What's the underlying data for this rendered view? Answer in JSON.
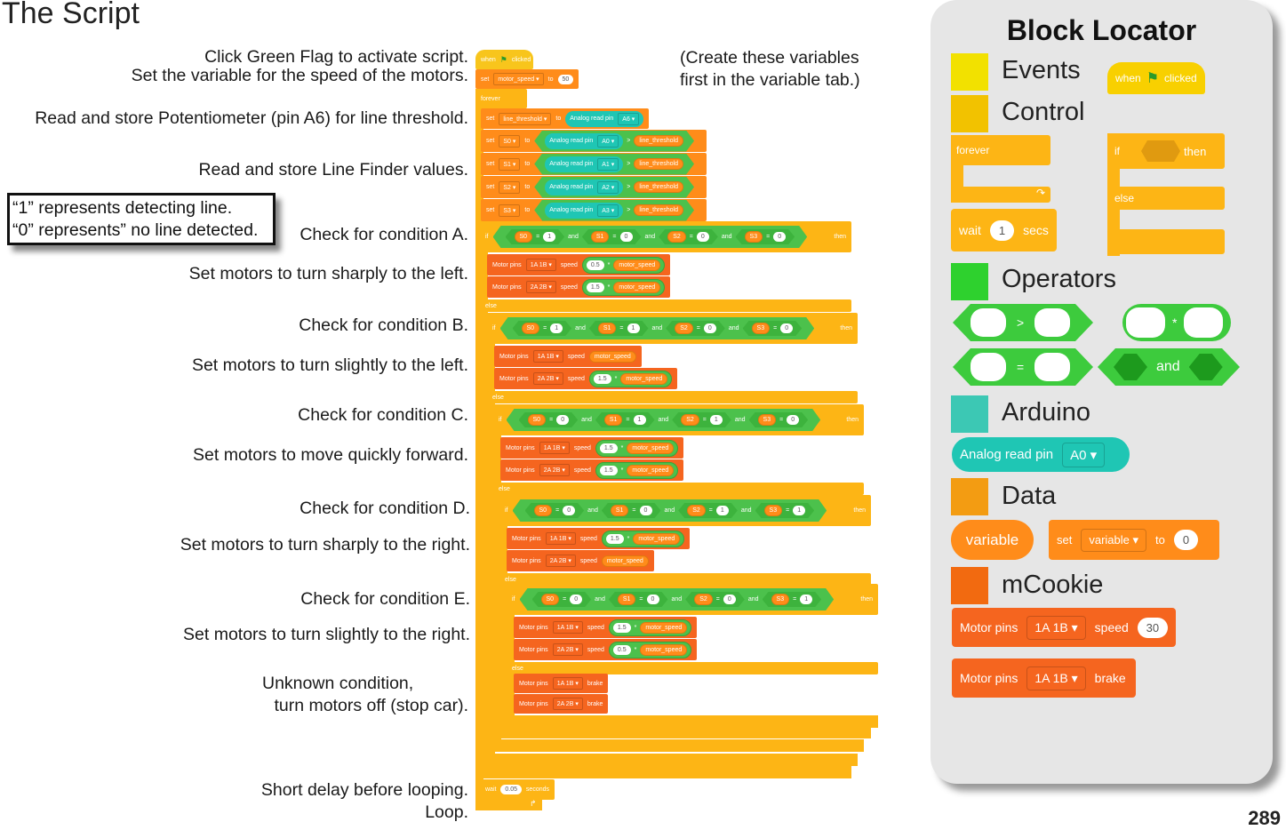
{
  "page_title": "The Script",
  "page_number": "289",
  "annotations": {
    "flag": "Click Green Flag to activate script.",
    "speed": "Set the variable for the speed of the motors.",
    "threshold": "Read and store Potentiometer (pin A6) for line threshold.",
    "finder": "Read and store Line Finder values.",
    "cond_a": "Check for condition A.",
    "act_a": "Set motors to turn sharply to the left.",
    "cond_b": "Check for condition B.",
    "act_b": "Set motors to turn slightly to the left.",
    "cond_c": "Check for condition C.",
    "act_c": "Set motors to move quickly forward.",
    "cond_d": "Check for condition D.",
    "act_d": "Set motors to turn sharply to the right.",
    "cond_e": "Check for condition E.",
    "act_e": "Set motors to turn slightly to the right.",
    "unknown_1": "Unknown condition,",
    "unknown_2": "turn motors off (stop car).",
    "delay": "Short delay before looping.",
    "loop": "Loop."
  },
  "note_box": [
    "“1” represents detecting line.",
    "“0” represents” no line detected."
  ],
  "variable_note": [
    "(Create these variables",
    "first in the variable tab.)"
  ],
  "script": {
    "labels": {
      "when": "when",
      "clicked": "clicked",
      "set": "set",
      "to": "to",
      "forever": "forever",
      "if": "if",
      "then": "then",
      "else": "else",
      "and": "and",
      "eq": "=",
      "gt": ">",
      "times": "*",
      "motor_pins": "Motor pins",
      "speed": "speed",
      "brake": "brake",
      "wait": "wait",
      "seconds": "seconds",
      "analog": "Analog read pin"
    },
    "init": {
      "var": "motor_speed",
      "value": "50"
    },
    "threshold": {
      "var": "line_threshold",
      "pin": "A6"
    },
    "sensors": [
      {
        "var": "S0",
        "pin": "A0"
      },
      {
        "var": "S1",
        "pin": "A1"
      },
      {
        "var": "S2",
        "pin": "A2"
      },
      {
        "var": "S3",
        "pin": "A3"
      }
    ],
    "compare_var": "line_threshold",
    "motor_var": "motor_speed",
    "conditions": [
      {
        "values": [
          "1",
          "0",
          "0",
          "0"
        ],
        "motors": [
          {
            "port": "1A 1B",
            "factor": "0.5"
          },
          {
            "port": "2A 2B",
            "factor": "1.5"
          }
        ]
      },
      {
        "values": [
          "1",
          "1",
          "0",
          "0"
        ],
        "motors": [
          {
            "port": "1A 1B",
            "factor": null
          },
          {
            "port": "2A 2B",
            "factor": "1.5"
          }
        ]
      },
      {
        "values": [
          "0",
          "1",
          "1",
          "0"
        ],
        "motors": [
          {
            "port": "1A 1B",
            "factor": "1.5"
          },
          {
            "port": "2A 2B",
            "factor": "1.5"
          }
        ]
      },
      {
        "values": [
          "0",
          "0",
          "1",
          "1"
        ],
        "motors": [
          {
            "port": "1A 1B",
            "factor": "1.5"
          },
          {
            "port": "2A 2B",
            "factor": null
          }
        ]
      },
      {
        "values": [
          "0",
          "0",
          "0",
          "1"
        ],
        "motors": [
          {
            "port": "1A 1B",
            "factor": "1.5"
          },
          {
            "port": "2A 2B",
            "factor": "0.5"
          }
        ]
      }
    ],
    "fallback": [
      {
        "port": "1A 1B"
      },
      {
        "port": "2A 2B"
      }
    ],
    "wait_value": "0.05"
  },
  "locator": {
    "title": "Block Locator",
    "categories": {
      "events": {
        "label": "Events",
        "color": "#F2E100"
      },
      "control": {
        "label": "Control",
        "color": "#F2C200"
      },
      "operators": {
        "label": "Operators",
        "color": "#2ED12E"
      },
      "arduino": {
        "label": "Arduino",
        "color": "#3CC8B4"
      },
      "data": {
        "label": "Data",
        "color": "#F39C12"
      },
      "mcookie": {
        "label": "mCookie",
        "color": "#F26A10"
      }
    },
    "blocks": {
      "when": "when",
      "clicked": "clicked",
      "forever": "forever",
      "if": "if",
      "then": "then",
      "else": "else",
      "wait": "wait",
      "wait_value": "1",
      "secs": "secs",
      "gt": ">",
      "times": "*",
      "eq": "=",
      "and": "and",
      "analog": "Analog read pin",
      "analog_pin": "A0",
      "variable": "variable",
      "set": "set",
      "set_var": "variable",
      "to": "to",
      "set_value": "0",
      "motor_pins": "Motor pins",
      "port": "1A 1B",
      "speed": "speed",
      "speed_value": "30",
      "brake": "brake"
    }
  }
}
